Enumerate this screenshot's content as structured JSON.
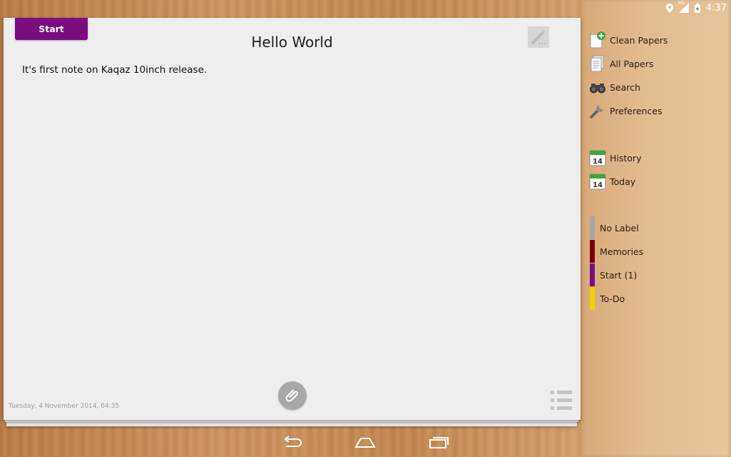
{
  "status_bar": {
    "time": "4:37",
    "network": "3G",
    "icons": [
      "location-icon",
      "signal-icon",
      "battery-icon"
    ]
  },
  "paper": {
    "label_tab": "Start",
    "label_color": "#7a0d80",
    "title": "Hello World",
    "body": "It's first note on Kaqaz 10inch release.",
    "date": "Tuesday, 4 November 2014, 04:35",
    "icons": [
      "edit-icon",
      "attach-icon",
      "list-icon"
    ]
  },
  "sidebar": {
    "items": [
      {
        "label": "Clean Papers",
        "icon": "clean-papers-icon"
      },
      {
        "label": "All Papers",
        "icon": "all-papers-icon"
      },
      {
        "label": "Search",
        "icon": "binoculars-icon"
      },
      {
        "label": "Preferences",
        "icon": "wrench-icon"
      }
    ],
    "calendar_items": [
      {
        "label": "History",
        "icon": "calendar-icon",
        "day": "14"
      },
      {
        "label": "Today",
        "icon": "calendar-icon",
        "day": "14"
      }
    ],
    "labels": [
      {
        "label": "No Label",
        "color": "#a6a6a6"
      },
      {
        "label": "Memories",
        "color": "#7a0000"
      },
      {
        "label": "Start (1)",
        "color": "#7a0d80"
      },
      {
        "label": "To-Do",
        "color": "#f2d000"
      }
    ]
  },
  "navbar": {
    "buttons": [
      "back-icon",
      "home-icon",
      "recents-icon"
    ]
  }
}
